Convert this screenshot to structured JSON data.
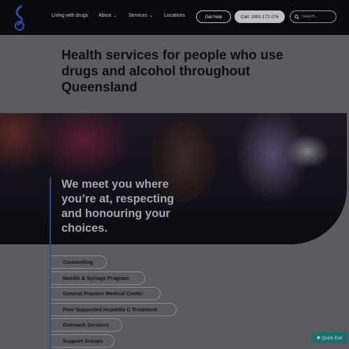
{
  "header": {
    "nav": {
      "living": "Living with drugs",
      "about": "About",
      "services": "Services",
      "locations": "Locations"
    },
    "get_help": "Get help",
    "call": "Call: 1800 172 076",
    "search_placeholder": "Search...",
    "chevron_glyph": "⌄",
    "search_glyph": "🔍"
  },
  "page_title": "Health services for people who use drugs and alcohol throughout Queensland",
  "hero": {
    "text": "We meet you where you’re at, respecting and honouring your choices."
  },
  "services": [
    "Counselling",
    "Needle & Syringe Program",
    "General Practice Medical Center",
    "Peer Supported Hepatitis C Treatment",
    "Outreach Services",
    "Support Groups"
  ],
  "quick_exit": "✖ Quick Exit",
  "colors": {
    "accent_bar": "#39458a",
    "quick_exit": "#1e6e6d",
    "header_bg": "#0a0a0e",
    "band_bg": "#5c5c60"
  }
}
